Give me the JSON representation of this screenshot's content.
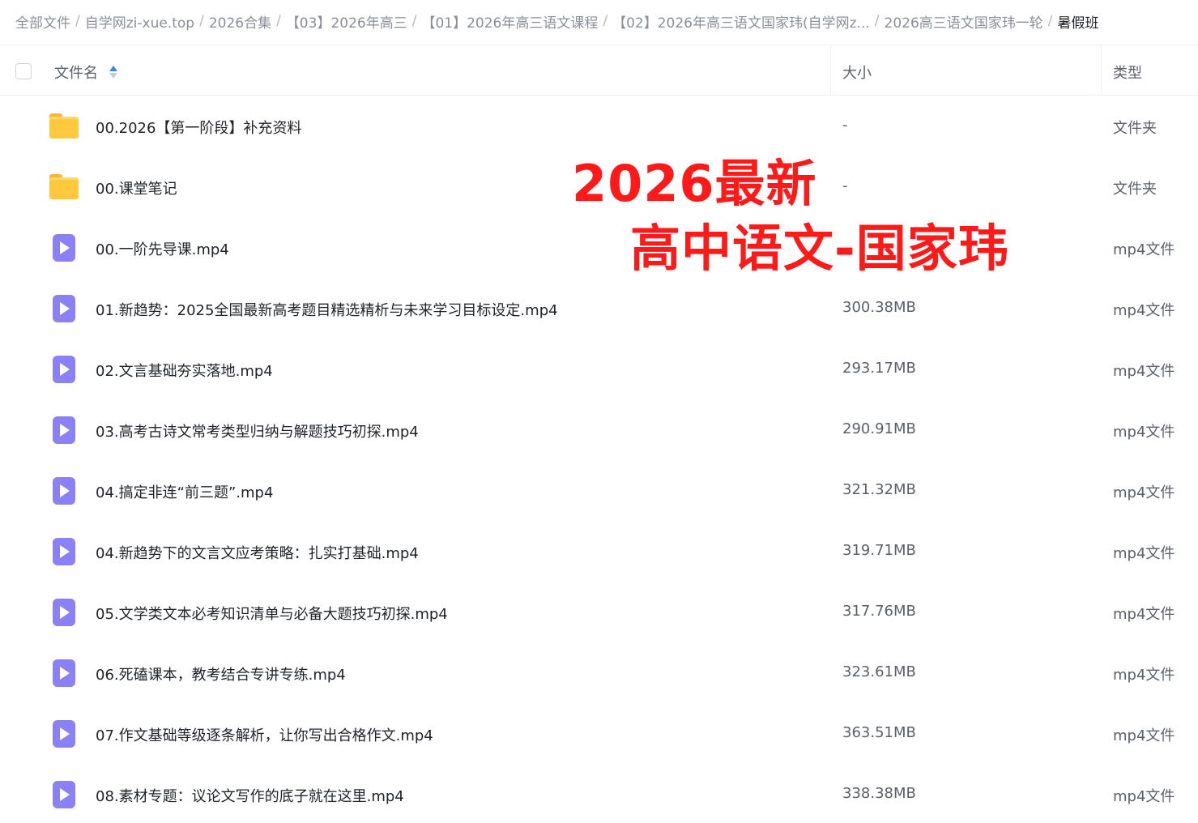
{
  "breadcrumb": [
    "全部文件",
    "自学网zi-xue.top",
    "2026合集",
    "【03】2026年高三",
    "【01】2026年高三语文课程",
    "【02】2026年高三语文国家玮(自学网z...",
    "2026高三语文国家玮一轮",
    "暑假班"
  ],
  "breadcrumb_separator": "/",
  "table": {
    "columns": {
      "name": "文件名",
      "size": "大小",
      "type": "类型"
    },
    "sort_color": "#3b82f6",
    "rows": [
      {
        "icon": "folder-icon",
        "name": "00.2026【第一阶段】补充资料",
        "size": "-",
        "type": "文件夹"
      },
      {
        "icon": "folder-icon",
        "name": "00.课堂笔记",
        "size": "-",
        "type": "文件夹"
      },
      {
        "icon": "video-icon",
        "name": "00.一阶先导课.mp4",
        "size": "",
        "type": "mp4文件"
      },
      {
        "icon": "video-icon",
        "name": "01.新趋势：2025全国最新高考题目精选精析与未来学习目标设定.mp4",
        "size": "300.38MB",
        "type": "mp4文件"
      },
      {
        "icon": "video-icon",
        "name": "02.文言基础夯实落地.mp4",
        "size": "293.17MB",
        "type": "mp4文件"
      },
      {
        "icon": "video-icon",
        "name": "03.高考古诗文常考类型归纳与解题技巧初探.mp4",
        "size": "290.91MB",
        "type": "mp4文件"
      },
      {
        "icon": "video-icon",
        "name": "04.搞定非连“前三题”.mp4",
        "size": "321.32MB",
        "type": "mp4文件"
      },
      {
        "icon": "video-icon",
        "name": "04.新趋势下的文言文应考策略：扎实打基础.mp4",
        "size": "319.71MB",
        "type": "mp4文件"
      },
      {
        "icon": "video-icon",
        "name": "05.文学类文本必考知识清单与必备大题技巧初探.mp4",
        "size": "317.76MB",
        "type": "mp4文件"
      },
      {
        "icon": "video-icon",
        "name": "06.死磕课本，教考结合专讲专练.mp4",
        "size": "323.61MB",
        "type": "mp4文件"
      },
      {
        "icon": "video-icon",
        "name": "07.作文基础等级逐条解析，让你写出合格作文.mp4",
        "size": "363.51MB",
        "type": "mp4文件"
      },
      {
        "icon": "video-icon",
        "name": "08.素材专题：议论文写作的底子就在这里.mp4",
        "size": "338.38MB",
        "type": "mp4文件"
      }
    ]
  },
  "overlay": {
    "line1": "2026最新",
    "line2": "高中语文-国家玮",
    "color": "#ff1a1a"
  },
  "colors": {
    "folder": "#ffc93e",
    "video": "#8b80f5"
  }
}
